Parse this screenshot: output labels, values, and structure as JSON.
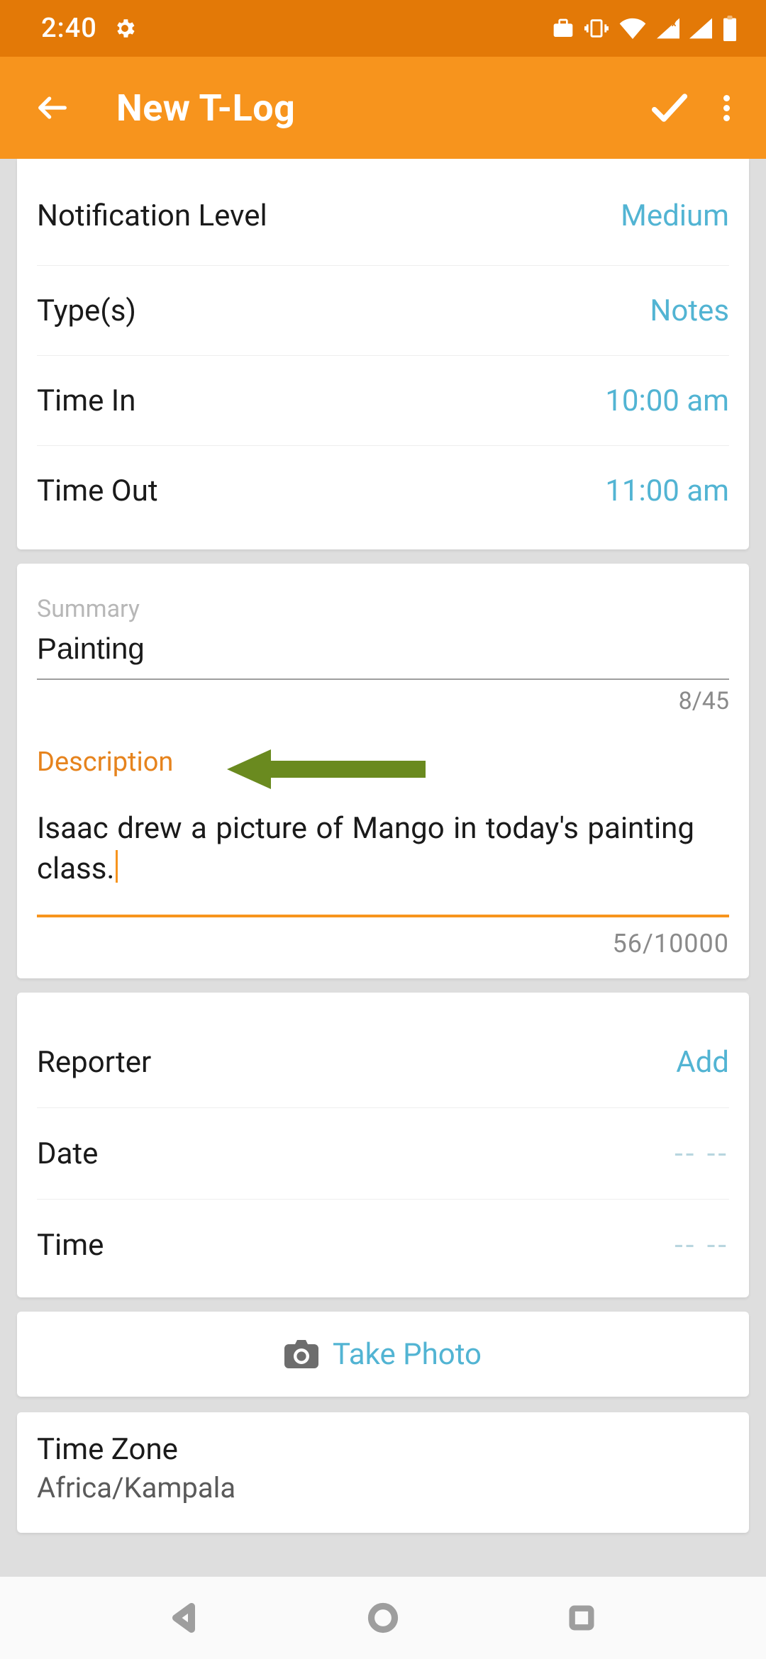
{
  "status": {
    "time": "2:40"
  },
  "header": {
    "title": "New T-Log"
  },
  "card1": {
    "notification_level_label": "Notification Level",
    "notification_level_value": "Medium",
    "types_label": "Type(s)",
    "types_value": "Notes",
    "time_in_label": "Time In",
    "time_in_value": "10:00 am",
    "time_out_label": "Time Out",
    "time_out_value": "11:00 am"
  },
  "card2": {
    "summary_label": "Summary",
    "summary_value": "Painting",
    "summary_counter": "8/45",
    "description_label": "Description",
    "description_value": "Isaac drew a picture of Mango in today's painting class.",
    "description_counter": "56/10000"
  },
  "card3": {
    "reporter_label": "Reporter",
    "reporter_value": "Add",
    "date_label": "Date",
    "date_value": "-- --",
    "time_label": "Time",
    "time_value": "-- --"
  },
  "card4": {
    "take_photo": "Take Photo"
  },
  "card5": {
    "tz_label": "Time Zone",
    "tz_value": "Africa/Kampala"
  }
}
